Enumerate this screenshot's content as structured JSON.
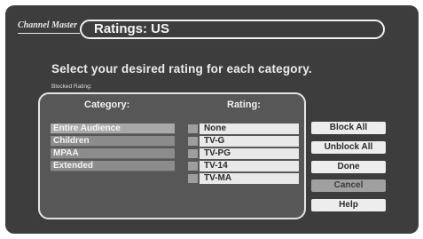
{
  "header": {
    "logo_text": "Channel Master",
    "title": "Ratings: US"
  },
  "instruction": "Select your desired rating for each category.",
  "blocked_rating_label": "Blocked Rating:",
  "panel": {
    "category_header": "Category:",
    "rating_header": "Rating:",
    "categories": [
      {
        "label": "Entire Audience",
        "selected": true
      },
      {
        "label": "Children",
        "selected": false
      },
      {
        "label": "MPAA",
        "selected": false
      },
      {
        "label": "Extended",
        "selected": false
      }
    ],
    "ratings": [
      {
        "label": "None"
      },
      {
        "label": "TV-G"
      },
      {
        "label": "TV-PG"
      },
      {
        "label": "TV-14"
      },
      {
        "label": "TV-MA"
      }
    ]
  },
  "buttons": {
    "block_all": "Block All",
    "unblock_all": "Unblock All",
    "done": "Done",
    "cancel": "Cancel",
    "help": "Help"
  },
  "colors": {
    "screen_bg": "#3d3d3d",
    "panel_bg": "#575757",
    "highlight": "#a0a0a0"
  }
}
